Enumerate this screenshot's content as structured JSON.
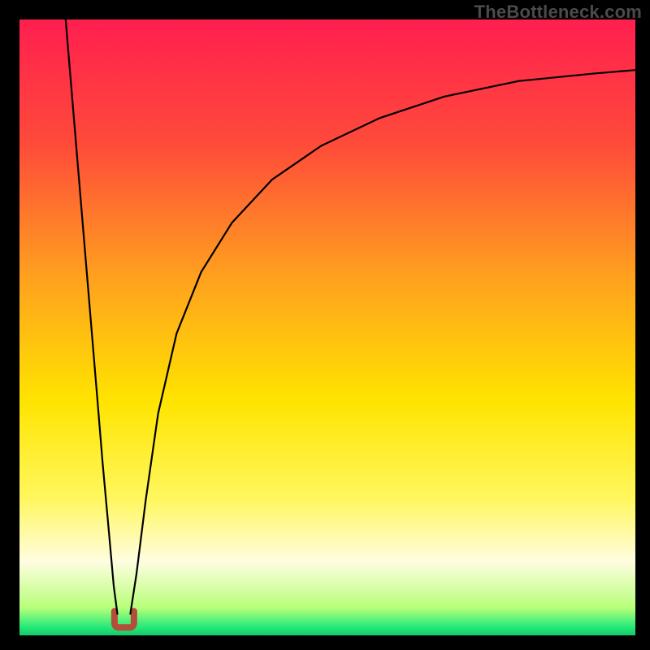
{
  "watermark": {
    "text": "TheBottleneck.com"
  },
  "frame": {
    "outer_w": 800,
    "outer_h": 800,
    "inner_x": 24,
    "inner_y": 24,
    "inner_w": 758,
    "inner_h": 758
  },
  "gradient": {
    "stops": [
      {
        "offset": 0.0,
        "color": "#ff1f4f"
      },
      {
        "offset": 0.2,
        "color": "#ff4a3a"
      },
      {
        "offset": 0.42,
        "color": "#ffa11e"
      },
      {
        "offset": 0.62,
        "color": "#ffe400"
      },
      {
        "offset": 0.78,
        "color": "#fff760"
      },
      {
        "offset": 0.88,
        "color": "#fffde0"
      },
      {
        "offset": 0.955,
        "color": "#b8ff7a"
      },
      {
        "offset": 0.985,
        "color": "#2beb7a"
      },
      {
        "offset": 1.0,
        "color": "#12c96b"
      }
    ]
  },
  "curve": {
    "stroke": "#000000",
    "stroke_width": 2.2,
    "left_branch_top_x_frac": 0.075,
    "right_branch_top_y_frac": 0.086
  },
  "chart_data": {
    "type": "line",
    "title": "",
    "xlabel": "",
    "ylabel": "",
    "xlim": [
      0,
      100
    ],
    "ylim": [
      0,
      100
    ],
    "series": [
      {
        "name": "left-branch",
        "x": [
          7.5,
          8.5,
          9.5,
          10.5,
          11.5,
          12.5,
          13.5,
          14.5,
          15.3,
          15.9
        ],
        "values": [
          100,
          88,
          76,
          64,
          52,
          40,
          28,
          17,
          8,
          3.5
        ]
      },
      {
        "name": "right-branch",
        "x": [
          18.0,
          19.0,
          20.5,
          22.5,
          25.5,
          29.5,
          34.5,
          41.0,
          49.0,
          58.5,
          69.0,
          81.0,
          93.0,
          100.0
        ],
        "values": [
          3.5,
          10,
          22,
          36,
          49,
          59,
          67,
          74,
          79.5,
          84,
          87.5,
          90,
          91.2,
          91.8
        ]
      }
    ],
    "annotations": [
      {
        "name": "dip-marker",
        "x": 17.0,
        "y": 2.5,
        "shape": "u",
        "color": "#b44d3a"
      }
    ]
  },
  "dip_marker": {
    "cx_frac": 0.17,
    "cy_frac": 0.974,
    "color": "#b44d3a",
    "w": 24,
    "h": 20
  }
}
